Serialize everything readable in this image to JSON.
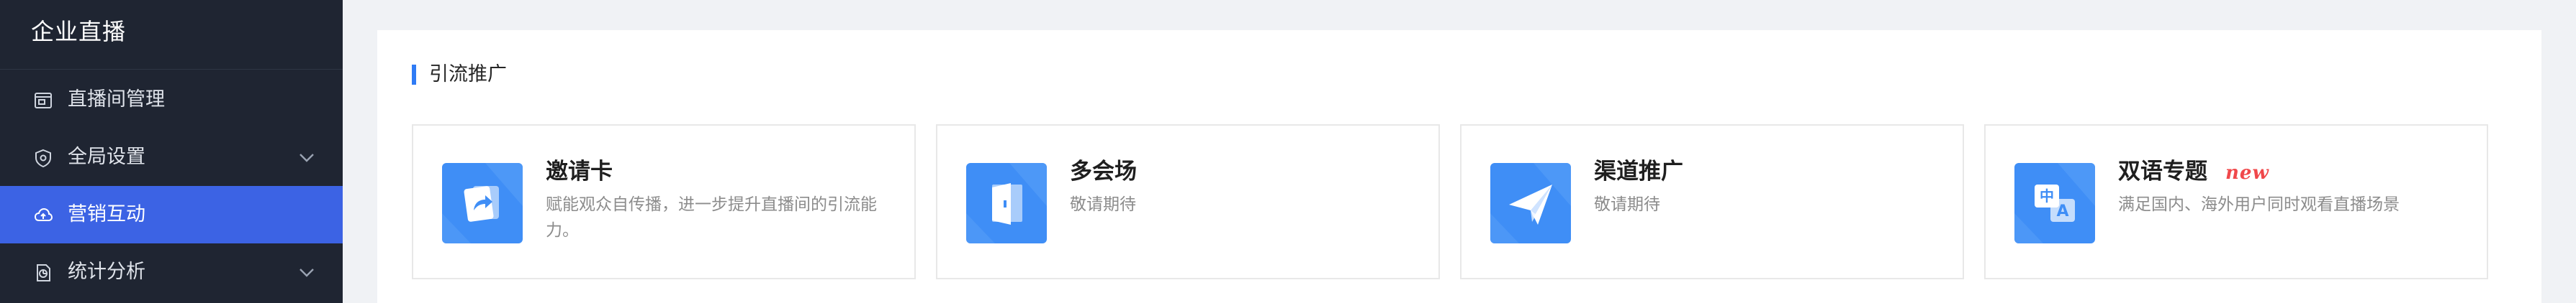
{
  "app": {
    "title": "企业直播"
  },
  "sidebar": {
    "items": [
      {
        "label": "直播间管理",
        "icon": "monitor-icon",
        "expandable": false,
        "active": false
      },
      {
        "label": "全局设置",
        "icon": "shield-icon",
        "expandable": true,
        "active": false
      },
      {
        "label": "营销互动",
        "icon": "cloud-icon",
        "expandable": false,
        "active": true
      },
      {
        "label": "统计分析",
        "icon": "chart-file-icon",
        "expandable": true,
        "active": false
      }
    ]
  },
  "main": {
    "section_title": "引流推广",
    "cards": [
      {
        "title": "邀请卡",
        "desc": "赋能观众自传播，进一步提升直播间的引流能力。",
        "icon": "share-card-icon",
        "badge": ""
      },
      {
        "title": "多会场",
        "desc": "敬请期待",
        "icon": "door-icon",
        "badge": ""
      },
      {
        "title": "渠道推广",
        "desc": "敬请期待",
        "icon": "paper-plane-icon",
        "badge": ""
      },
      {
        "title": "双语专题",
        "desc": "满足国内、海外用户同时观看直播场景",
        "icon": "translate-icon",
        "badge": "new"
      }
    ]
  },
  "colors": {
    "sidebar_bg": "#1f2532",
    "active_item": "#3c63e4",
    "accent": "#2f7bf5",
    "badge": "#f0484b"
  }
}
